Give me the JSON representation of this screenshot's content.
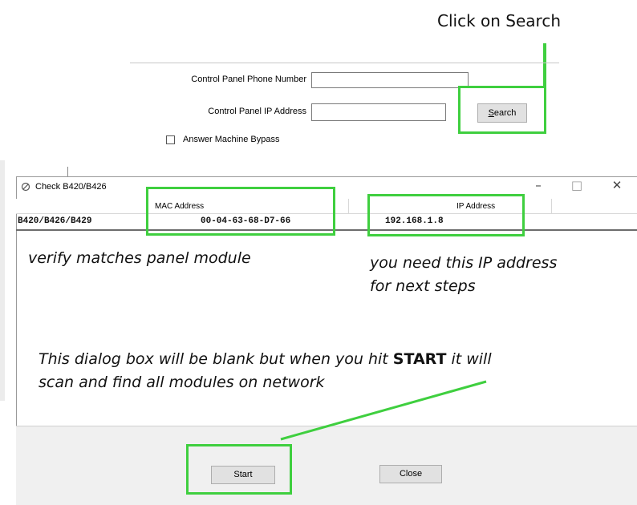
{
  "annotations": {
    "click_search": "Click on Search",
    "verify_mac": "verify matches panel module",
    "ip_note_line1": "you need this IP address",
    "ip_note_line2": "for next steps",
    "dialog_note_part1": "This dialog box will be blank but when you hit ",
    "dialog_note_emph": "START",
    "dialog_note_part2": " it will",
    "dialog_note_line2": "scan and find all modules on network"
  },
  "form": {
    "phone_label": "Control Panel Phone Number",
    "phone_value": "",
    "ip_label": "Control Panel IP Address",
    "ip_value": "",
    "search_button_accel": "S",
    "search_button_rest": "earch",
    "answer_bypass_label": "Answer Machine Bypass",
    "answer_bypass_checked": false
  },
  "dialog": {
    "title": "Check B420/B426",
    "minimize": "–",
    "maximize": "□",
    "close": "✕",
    "columns": [
      "MAC Address",
      "IP Address"
    ],
    "rows": [
      {
        "name": "B420/B426/B429",
        "mac": "00-04-63-68-D7-66",
        "ip": "192.168.1.8"
      }
    ],
    "start_button": "Start",
    "close_button": "Close"
  },
  "colors": {
    "highlight": "#3fcf3f",
    "panel_bg": "#f0f0f0",
    "button_bg": "#e1e1e1"
  },
  "icons": {
    "dialog_icon": "network-plug-icon"
  }
}
